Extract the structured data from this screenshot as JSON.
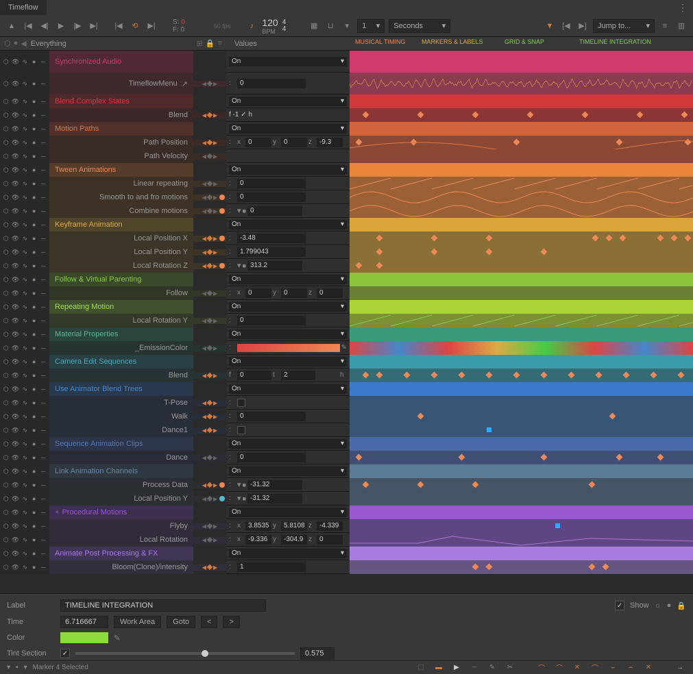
{
  "window": {
    "title": "Timeflow"
  },
  "toolbar": {
    "s_value": "0",
    "f_value": "0",
    "fps": "60 fps",
    "bpm": "120",
    "bpm_label": "BPM",
    "time_sig_top": "4",
    "time_sig_bottom": "4",
    "num_dropdown": "1",
    "unit_dropdown": "Seconds",
    "jump_dropdown": "Jump to..."
  },
  "left_header": {
    "title": "Everything"
  },
  "middle_header": {
    "title": "Values"
  },
  "tracks": [
    {
      "id": "sync-audio",
      "label": "Synchronized Audio",
      "color": "#d13a6b",
      "bg": "rgba(140,40,70,0.4)",
      "kf": false,
      "tl_color": "#d13a6b",
      "value": "On"
    },
    {
      "id": "sync-audio-sub",
      "label": "TimeflowMenu",
      "color": "#999",
      "bg": "rgba(100,40,50,0.35)",
      "sub": true,
      "kf": false,
      "tl_color": "#8b3a50",
      "value_num": "0",
      "extra": "menu",
      "tl_wave": true
    },
    {
      "id": "blend-complex",
      "label": "Blend Complex States",
      "color": "#d34",
      "bg": "rgba(140,40,40,0.4)",
      "kf": false,
      "tl_color": "#d13a3a",
      "value": "On"
    },
    {
      "id": "blend-complex-sub",
      "label": "Blend",
      "color": "#999",
      "bg": "rgba(90,35,35,0.35)",
      "sub": true,
      "kf": true,
      "tl_color": "#8b3535",
      "value_custom": "f -1 ✓ h",
      "kf_dots": [
        20,
        100,
        180,
        260,
        340,
        420,
        485
      ]
    },
    {
      "id": "motion-paths",
      "label": "Motion Paths",
      "color": "#d74",
      "bg": "rgba(140,60,40,0.4)",
      "kf": false,
      "tl_color": "#d1643a",
      "value": "On"
    },
    {
      "id": "path-pos",
      "label": "Path Position",
      "color": "#999",
      "bg": "rgba(90,45,35,0.35)",
      "sub": true,
      "kf": true,
      "tl_color": "#8b4835",
      "value_xyz": [
        "0",
        "0",
        "-9.3"
      ],
      "kf_dots": [
        10,
        90,
        240,
        390,
        490
      ],
      "curve": true,
      "curve_color": "#d74"
    },
    {
      "id": "path-vel",
      "label": "Path Velocity",
      "color": "#999",
      "bg": "rgba(90,45,35,0.35)",
      "sub": true,
      "kf": false,
      "tl_color": "#8b4835"
    },
    {
      "id": "tween",
      "label": "Tween Animations",
      "color": "#e85",
      "bg": "rgba(150,90,40,0.4)",
      "kf": false,
      "tl_color": "#e8853a",
      "value": "On"
    },
    {
      "id": "linear-rep",
      "label": "Linear repeating",
      "color": "#999",
      "bg": "rgba(100,65,35,0.35)",
      "sub": true,
      "kf": false,
      "tl_color": "#9b6035",
      "value_num": "0",
      "curve": true,
      "curve_color": "#e85",
      "curve_type": "saw"
    },
    {
      "id": "smooth-tf",
      "label": "Smooth to and fro motions",
      "color": "#999",
      "bg": "rgba(100,65,35,0.35)",
      "sub": true,
      "kf": false,
      "tl_color": "#9b6035",
      "value_num": "0",
      "curve": true,
      "curve_color": "#e85",
      "curve_type": "sine",
      "dot": true
    },
    {
      "id": "combine",
      "label": "Combine motions",
      "color": "#999",
      "bg": "rgba(100,65,35,0.35)",
      "sub": true,
      "kf": false,
      "tl_color": "#9b6035",
      "value_dd": "0",
      "curve": true,
      "curve_color": "#e85",
      "curve_type": "sine",
      "dot": true
    },
    {
      "id": "keyframe",
      "label": "Keyframe Animation",
      "color": "#da4",
      "bg": "rgba(140,110,40,0.4)",
      "kf": false,
      "tl_color": "#daa43a",
      "value": "On"
    },
    {
      "id": "localx",
      "label": "Local Position X",
      "color": "#999",
      "bg": "rgba(95,75,35,0.35)",
      "sub": true,
      "kf": true,
      "tl_color": "#8b7035",
      "value_num": "-3.48",
      "kf_dots": [
        40,
        120,
        200,
        355,
        375,
        395,
        450,
        470,
        490
      ],
      "dot": true
    },
    {
      "id": "localy",
      "label": "Local Position Y",
      "color": "#999",
      "bg": "rgba(95,75,35,0.35)",
      "sub": true,
      "kf": true,
      "tl_color": "#8b7035",
      "value_num": "1.799043",
      "kf_dots": [
        40,
        120,
        200,
        280
      ]
    },
    {
      "id": "localrz",
      "label": "Local Rotation Z",
      "color": "#999",
      "bg": "rgba(95,75,35,0.35)",
      "sub": true,
      "kf": true,
      "tl_color": "#8b7035",
      "value_dd": "313.2",
      "kf_dots": [
        10,
        40
      ],
      "dot": true
    },
    {
      "id": "follow",
      "label": "Follow & Virtual Parenting",
      "color": "#8c4",
      "bg": "rgba(80,120,40,0.4)",
      "kf": false,
      "tl_color": "#8cc43a",
      "value": "On"
    },
    {
      "id": "follow-sub",
      "label": "Follow",
      "color": "#999",
      "bg": "rgba(60,80,35,0.35)",
      "sub": true,
      "kf": false,
      "tl_color": "#6b8035",
      "value_xyz": [
        "0",
        "0",
        "0"
      ]
    },
    {
      "id": "repeating",
      "label": "Repeating Motion",
      "color": "#ad5",
      "bg": "rgba(100,140,50,0.4)",
      "kf": false,
      "tl_color": "#add53a",
      "value": "On"
    },
    {
      "id": "localry",
      "label": "Local Rotation Y",
      "color": "#999",
      "bg": "rgba(70,90,40,0.35)",
      "sub": true,
      "kf": false,
      "tl_color": "#7b9035",
      "value_num": "0",
      "curve": true,
      "curve_color": "#8c5",
      "curve_type": "saw"
    },
    {
      "id": "material",
      "label": "Material Properties",
      "color": "#5b9",
      "bg": "rgba(40,110,90,0.4)",
      "kf": false,
      "tl_color": "#3a9b7b",
      "value": "On"
    },
    {
      "id": "emission",
      "label": "_EmissionColor",
      "color": "#999",
      "bg": "rgba(35,75,65,0.35)",
      "sub": true,
      "kf": false,
      "tl_color": "gradient",
      "value_color": true
    },
    {
      "id": "camera",
      "label": "Camera Edit Sequences",
      "color": "#4ab",
      "bg": "rgba(40,100,110,0.4)",
      "kf": false,
      "tl_color": "#3a9bab",
      "value": "On"
    },
    {
      "id": "camera-blend",
      "label": "Blend",
      "color": "#999",
      "bg": "rgba(35,70,75,0.35)",
      "sub": true,
      "kf": true,
      "tl_color": "#356b75",
      "value_ft": [
        "0",
        "2"
      ],
      "kf_dots": [
        20,
        40,
        80,
        120,
        160,
        200,
        240,
        280,
        320,
        360,
        400,
        440,
        480
      ]
    },
    {
      "id": "animator",
      "label": "Use Animator Blend Trees",
      "color": "#48c",
      "bg": "rgba(40,80,130,0.4)",
      "kf": false,
      "tl_color": "#3a7bcb",
      "value": "On"
    },
    {
      "id": "tpose",
      "label": "T-Pose",
      "color": "#999",
      "bg": "rgba(35,55,85,0.35)",
      "sub": true,
      "kf": true,
      "tl_color": "#385575",
      "value_check": false
    },
    {
      "id": "walk",
      "label": "Walk",
      "color": "#999",
      "bg": "rgba(35,55,85,0.35)",
      "sub": true,
      "kf": true,
      "tl_color": "#385575",
      "value_num": "0",
      "kf_dots": [
        100,
        380
      ]
    },
    {
      "id": "dance1",
      "label": "Dance1",
      "color": "#999",
      "bg": "rgba(35,55,85,0.35)",
      "sub": true,
      "kf": true,
      "tl_color": "#385575",
      "value_check": false,
      "kf_dots": [
        200
      ],
      "kf_sq": true
    },
    {
      "id": "seq-clips",
      "label": "Sequence Animation Clips",
      "color": "#57b",
      "bg": "rgba(50,70,120,0.4)",
      "kf": false,
      "tl_color": "#4a6bab",
      "value": "On"
    },
    {
      "id": "dance",
      "label": "Dance",
      "color": "#999",
      "bg": "rgba(40,50,80,0.35)",
      "sub": true,
      "kf": false,
      "tl_color": "#405075",
      "value_num": "0",
      "kf_dots": [
        10,
        160,
        280,
        390,
        450
      ]
    },
    {
      "id": "link",
      "label": "Link Animation Channels",
      "color": "#68a",
      "bg": "rgba(55,75,100,0.4)",
      "kf": false,
      "tl_color": "#5b7a95",
      "value": "On"
    },
    {
      "id": "process",
      "label": "Process Data",
      "color": "#999",
      "bg": "rgba(45,55,70,0.35)",
      "sub": true,
      "kf": true,
      "tl_color": "#455565",
      "value_dd": "-31.32",
      "kf_dots": [
        20,
        100,
        180,
        350
      ],
      "dot": true
    },
    {
      "id": "localpy",
      "label": "Local Position Y",
      "color": "#999",
      "bg": "rgba(45,55,70,0.35)",
      "sub": true,
      "kf": false,
      "tl_color": "#455565",
      "value_dd": "-31.32",
      "dot": true,
      "dot_color": "#5bc"
    },
    {
      "id": "procedural",
      "label": "Procedural Motions",
      "color": "#95d",
      "bg": "rgba(90,55,140,0.4)",
      "kf": false,
      "tl_color": "#9a58d0",
      "value": "On",
      "plus": true
    },
    {
      "id": "flyby",
      "label": "Flyby",
      "color": "#999",
      "bg": "rgba(65,45,90,0.35)",
      "sub": true,
      "kf": false,
      "tl_color": "#604585",
      "value_xyz": [
        "3.8535",
        "5.8108",
        "-4.339"
      ],
      "kf_dots": [
        300
      ],
      "kf_sq": true
    },
    {
      "id": "localrot",
      "label": "Local Rotation",
      "color": "#999",
      "bg": "rgba(65,45,90,0.35)",
      "sub": true,
      "kf": false,
      "tl_color": "#604585",
      "value_xyz": [
        "-9.336",
        "-304.9",
        "0"
      ],
      "curve": true,
      "curve_color": "#a7c",
      "curve_type": "proc"
    },
    {
      "id": "postfx",
      "label": "Animate Post Processing & FX",
      "color": "#a7e",
      "bg": "rgba(100,70,150,0.4)",
      "kf": false,
      "tl_color": "#a87de0",
      "value": "On"
    },
    {
      "id": "bloom",
      "label": "Bloom(Clone)/intensity",
      "color": "#999",
      "bg": "rgba(70,55,95,0.35)",
      "sub": true,
      "kf": true,
      "tl_color": "#655580",
      "value_num": "1",
      "kf_dots": [
        180,
        200,
        350,
        370
      ]
    }
  ],
  "markers": {
    "m1": "MUSICAL TIMING",
    "m2": "MARKERS & LABELS",
    "m3": "GRID & SNAP",
    "m4": "TIMELINE INTEGRATION"
  },
  "bottom": {
    "label_lbl": "Label",
    "label_value": "TIMELINE INTEGRATION",
    "show_lbl": "Show",
    "time_lbl": "Time",
    "time_value": "6.716667",
    "workarea_btn": "Work Area",
    "goto_btn": "Goto",
    "prev_btn": "<",
    "next_btn": ">",
    "color_lbl": "Color",
    "color_value": "#8cdd3a",
    "tint_lbl": "Tint Section",
    "tint_value": "0.575"
  },
  "status": {
    "text": "Marker 4 Selected"
  }
}
